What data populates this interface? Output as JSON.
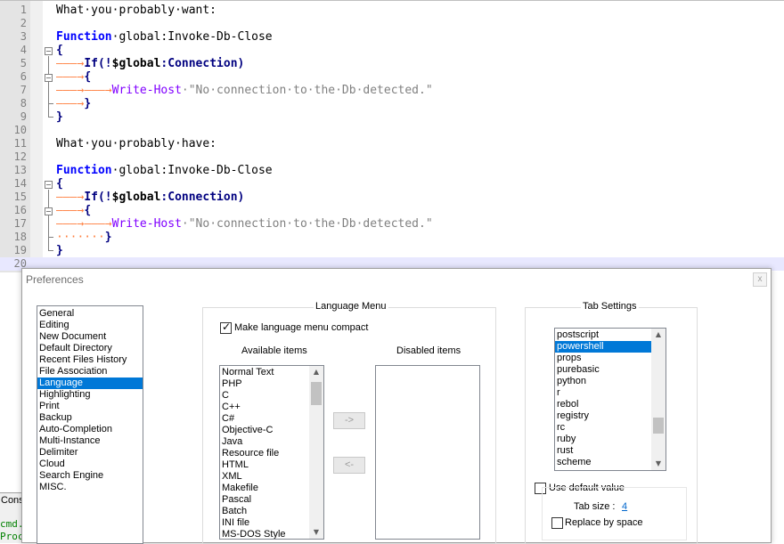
{
  "editor": {
    "lines": [
      {
        "n": "1"
      },
      {
        "n": "2"
      },
      {
        "n": "3"
      },
      {
        "n": "4"
      },
      {
        "n": "5"
      },
      {
        "n": "6"
      },
      {
        "n": "7"
      },
      {
        "n": "8"
      },
      {
        "n": "9"
      },
      {
        "n": "10"
      },
      {
        "n": "11"
      },
      {
        "n": "12"
      },
      {
        "n": "13"
      },
      {
        "n": "14"
      },
      {
        "n": "15"
      },
      {
        "n": "16"
      },
      {
        "n": "17"
      },
      {
        "n": "18"
      },
      {
        "n": "19"
      },
      {
        "n": "20"
      }
    ],
    "comment_want": "What·you·probably·want:",
    "comment_have": "What·you·probably·have:",
    "kw_function": "Function",
    "func_name": "·global:Invoke-Db-Close",
    "open_brace": "{",
    "close_brace": "}",
    "tab_arrow": "———→",
    "kw_if": "If(!",
    "var_global": "$global",
    "connection": ":Connection)",
    "write_host": "Write-Host",
    "string": "·\"No·connection·to·the·Db·detected.\"",
    "space_dots": "·······"
  },
  "console": {
    "tab": "Cons",
    "line1": "cmd.",
    "line2": "Proc"
  },
  "preferences": {
    "title": "Preferences",
    "close": "x",
    "categories": [
      "General",
      "Editing",
      "New Document",
      "Default Directory",
      "Recent Files History",
      "File Association",
      "Language",
      "Highlighting",
      "Print",
      "Backup",
      "Auto-Completion",
      "Multi-Instance",
      "Delimiter",
      "Cloud",
      "Search Engine",
      "MISC."
    ],
    "selected_category": "Language",
    "language_menu": {
      "group_title": "Language Menu",
      "compact_label": "Make language menu compact",
      "compact_checked": true,
      "available_title": "Available items",
      "disabled_title": "Disabled items",
      "available_items": [
        "Normal Text",
        "PHP",
        "C",
        "C++",
        "C#",
        "Objective-C",
        "Java",
        "Resource file",
        "HTML",
        "XML",
        "Makefile",
        "Pascal",
        "Batch",
        "INI file",
        "MS-DOS Style"
      ],
      "disabled_items": [],
      "move_right": "->",
      "move_left": "<-"
    },
    "tab_settings": {
      "group_title": "Tab Settings",
      "languages": [
        "postscript",
        "powershell",
        "props",
        "purebasic",
        "python",
        "r",
        "rebol",
        "registry",
        "rc",
        "ruby",
        "rust",
        "scheme"
      ],
      "selected_language": "powershell",
      "use_default_label": "Use default value",
      "use_default_checked": false,
      "tab_size_label": "Tab size :",
      "tab_size_value": "4",
      "replace_label": "Replace by space",
      "replace_checked": false
    }
  },
  "colors": {
    "keyword": "#0000ff",
    "cmdlet": "#8000ff",
    "string": "#808080",
    "whitespace": "#ff8040",
    "selection": "#0078d7",
    "current_line": "#e8e8ff"
  }
}
